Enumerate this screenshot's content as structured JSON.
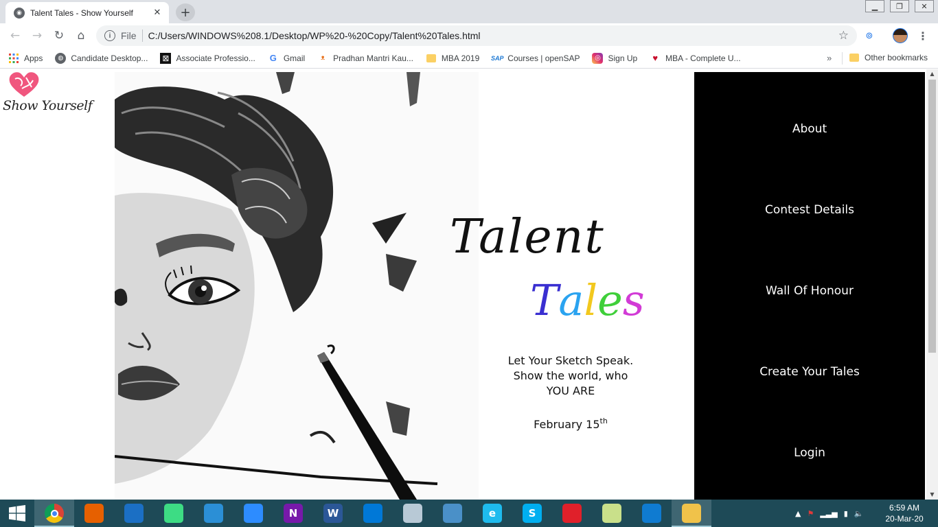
{
  "browser": {
    "tab_title": "Talent Tales - Show Yourself",
    "new_tab": "+",
    "url_scheme": "File",
    "url": "C:/Users/WINDOWS%208.1/Desktop/WP%20-%20Copy/Talent%20Tales.html",
    "bookmarks": [
      {
        "label": "Apps",
        "icon": "apps-grid-icon"
      },
      {
        "label": "Candidate Desktop...",
        "icon": "globe-icon"
      },
      {
        "label": "Associate Professio...",
        "icon": "pattern-icon"
      },
      {
        "label": "Gmail",
        "icon": "google-icon"
      },
      {
        "label": "Pradhan Mantri Kau...",
        "icon": "pmkvy-icon"
      },
      {
        "label": "MBA 2019",
        "icon": "folder-icon"
      },
      {
        "label": "Courses | openSAP",
        "icon": "sap-icon"
      },
      {
        "label": "Sign Up",
        "icon": "instagram-icon"
      },
      {
        "label": "MBA - Complete U...",
        "icon": "heart-logo-icon"
      }
    ],
    "more_bookmarks": "»",
    "other_bookmarks": "Other bookmarks"
  },
  "page": {
    "logo_text": "Show Yourself",
    "title_line1": "Talent",
    "title_line2_letters": [
      "T",
      "a",
      "l",
      "e",
      "s"
    ],
    "title_line2_colors": [
      "#3a2fd1",
      "#2aa3f0",
      "#f2c81e",
      "#3fcf3a",
      "#d23bd6"
    ],
    "tagline_lines": [
      "Let Your Sketch Speak.",
      "Show the world, who",
      "YOU ARE"
    ],
    "date_text": "February 15",
    "date_suffix": "th",
    "nav": [
      "About",
      "Contest Details",
      "Wall Of Honour",
      "Create Your Tales",
      "Login"
    ]
  },
  "taskbar": {
    "apps": [
      {
        "name": "chrome",
        "icon": "chrome-icon",
        "color": "#ffffff",
        "label": "",
        "active": true
      },
      {
        "name": "firefox",
        "icon": "firefox-icon",
        "color": "#e66000",
        "label": ""
      },
      {
        "name": "eclipse-moon",
        "icon": "moon-icon",
        "color": "#1b6fc4",
        "label": ""
      },
      {
        "name": "android-studio",
        "icon": "android-studio-icon",
        "color": "#3ddc84",
        "label": ""
      },
      {
        "name": "frame-app",
        "icon": "frame-icon",
        "color": "#2b8fd6",
        "label": ""
      },
      {
        "name": "zoom",
        "icon": "video-camera-icon",
        "color": "#2d8cff",
        "label": ""
      },
      {
        "name": "onenote",
        "icon": "onenote-icon",
        "color": "#7719aa",
        "label": "N"
      },
      {
        "name": "word",
        "icon": "word-icon",
        "color": "#2b5797",
        "label": "W"
      },
      {
        "name": "vscode",
        "icon": "vscode-icon",
        "color": "#0078d7",
        "label": ""
      },
      {
        "name": "snipping-tool",
        "icon": "scissors-icon",
        "color": "#b8c9d6",
        "label": ""
      },
      {
        "name": "remote-desktop",
        "icon": "monitor-icon",
        "color": "#4a90c8",
        "label": ""
      },
      {
        "name": "internet-explorer",
        "icon": "ie-icon",
        "color": "#1ebbee",
        "label": "e"
      },
      {
        "name": "skype",
        "icon": "skype-icon",
        "color": "#00aff0",
        "label": "S"
      },
      {
        "name": "downloader",
        "icon": "download-icon",
        "color": "#e0202a",
        "label": ""
      },
      {
        "name": "sticky-notes",
        "icon": "notes-icon",
        "color": "#c9e08a",
        "label": ""
      },
      {
        "name": "edge",
        "icon": "edge-icon",
        "color": "#0f7bd1",
        "label": ""
      },
      {
        "name": "file-explorer",
        "icon": "folder-icon",
        "color": "#f0c24a",
        "label": "",
        "active": true
      }
    ],
    "time": "6:59 AM",
    "date": "20-Mar-20"
  }
}
